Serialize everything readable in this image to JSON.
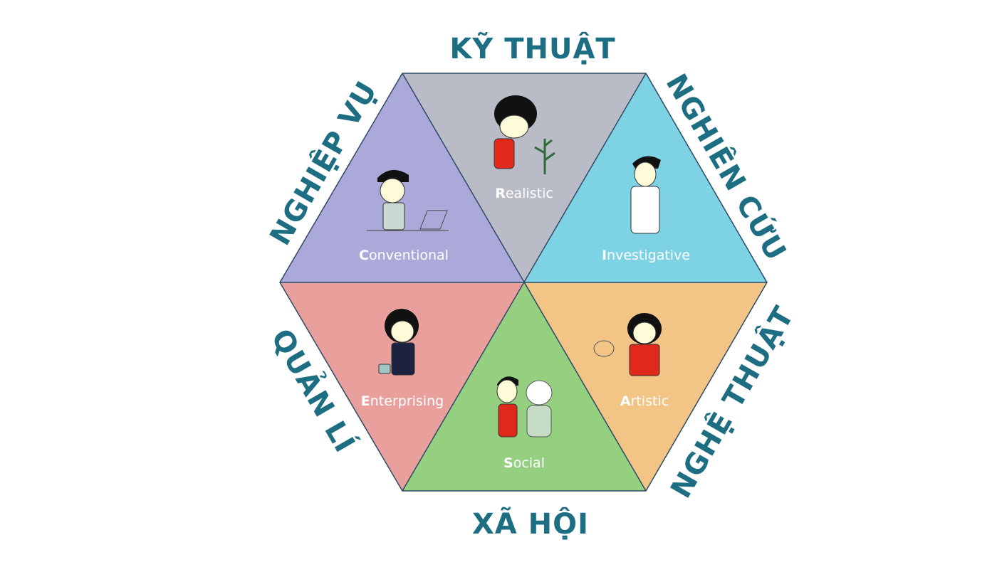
{
  "categories": {
    "top": "KỸ THUẬT",
    "top_right": "NGHIÊN CỨU",
    "bottom_right": "NGHỆ THUẬT",
    "bottom": "XÃ HỘI",
    "bottom_left": "QUẢN LÍ",
    "top_left": "NGHIỆP VỤ"
  },
  "types": [
    {
      "key": "realistic",
      "initial": "R",
      "rest": "ealistic",
      "color": "#b9bcc6",
      "icon": "gardener-icon"
    },
    {
      "key": "investigative",
      "initial": "I",
      "rest": "nvestigative",
      "color": "#7dd3e4",
      "icon": "doctor-icon"
    },
    {
      "key": "artistic",
      "initial": "A",
      "rest": "rtistic",
      "color": "#f2c586",
      "icon": "painter-icon"
    },
    {
      "key": "social",
      "initial": "S",
      "rest": "ocial",
      "color": "#94d080",
      "icon": "caregiver-icon"
    },
    {
      "key": "enterprising",
      "initial": "E",
      "rest": "nterprising",
      "color": "#e9a09d",
      "icon": "businesswoman-icon"
    },
    {
      "key": "conventional",
      "initial": "C",
      "rest": "onventional",
      "color": "#aba9da",
      "icon": "office-worker-icon"
    }
  ],
  "text_color": "#1d6e82",
  "edge_color": "#2c4a66"
}
